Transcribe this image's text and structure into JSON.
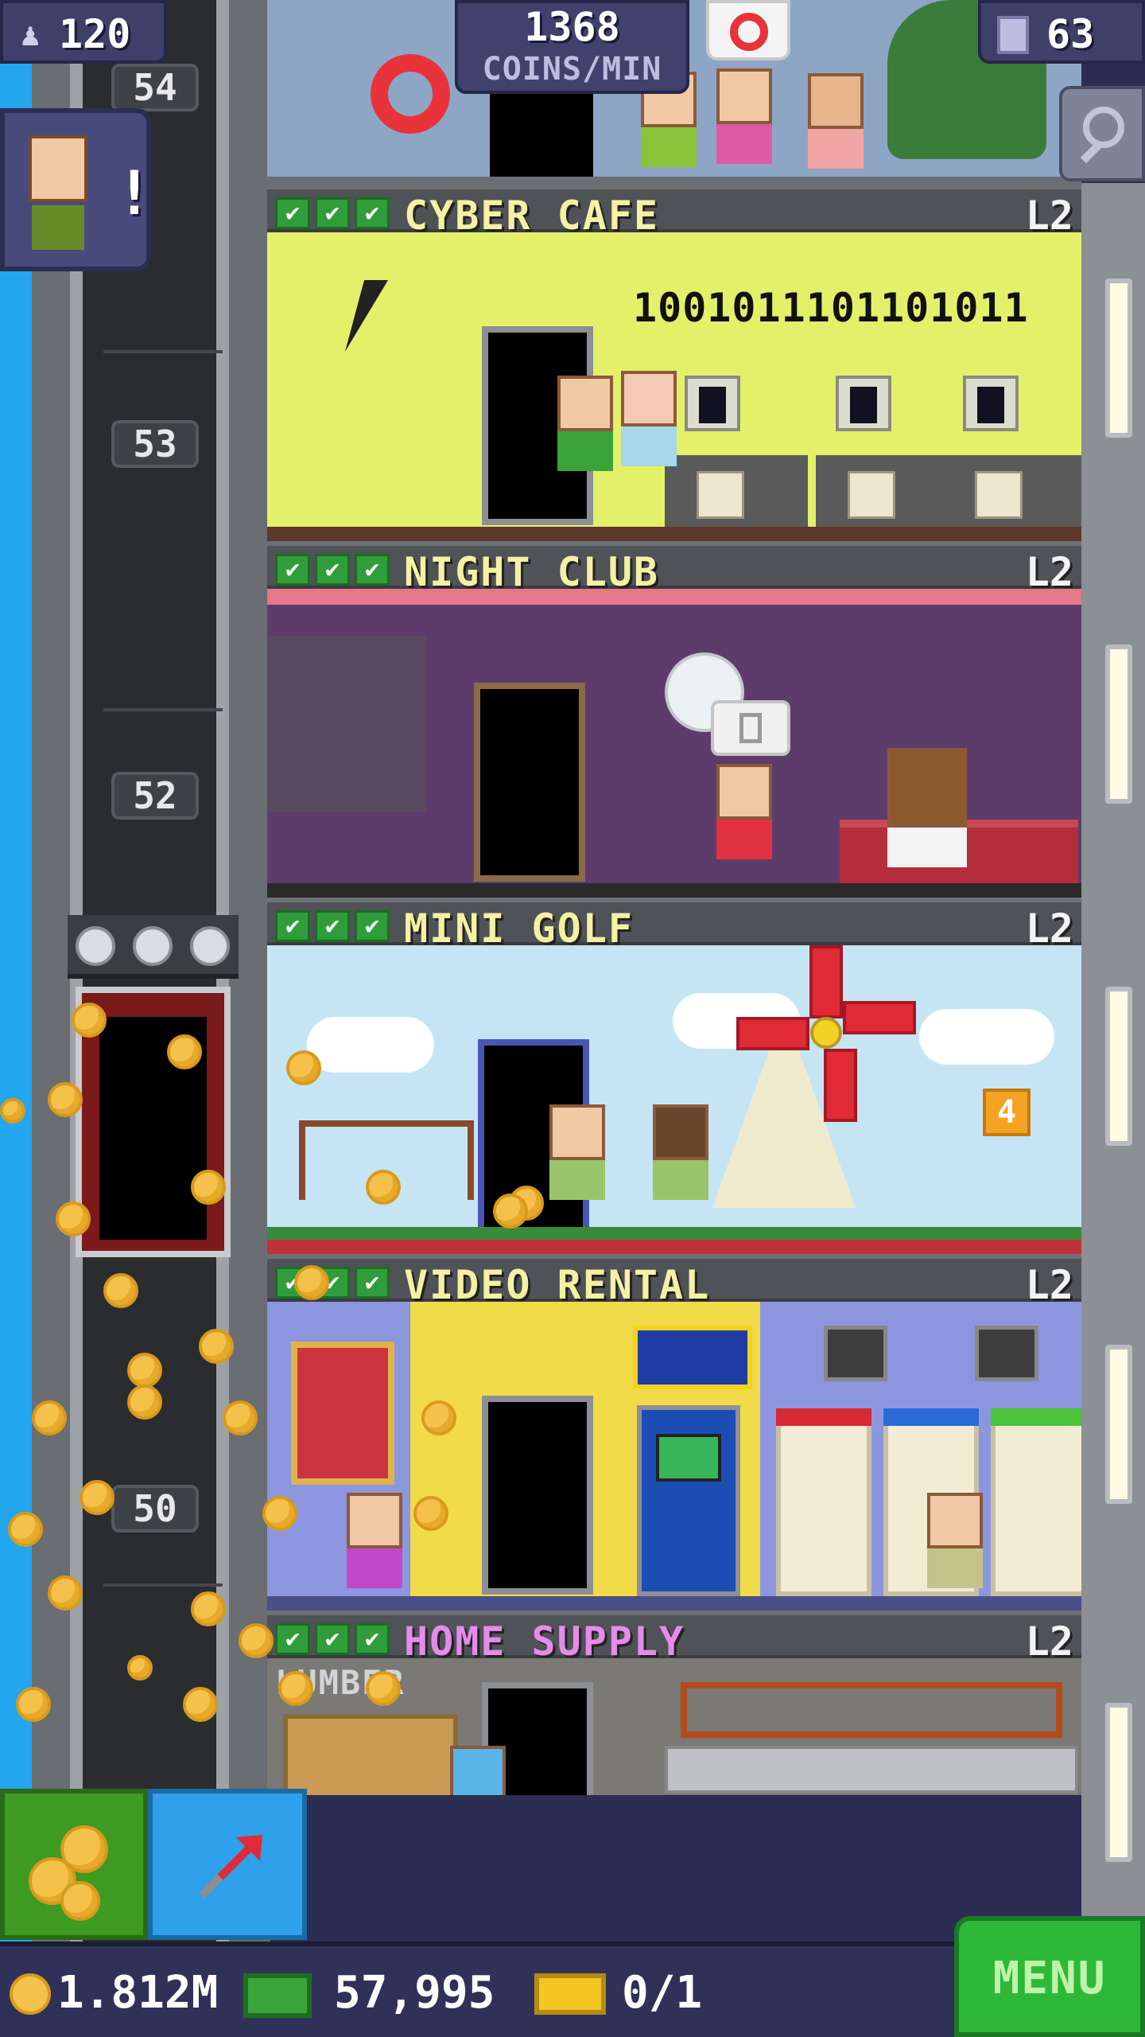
{
  "hud": {
    "population": "120",
    "coins_per_min_value": "1368",
    "coins_per_min_label": "COINS/MIN",
    "floor_count": "63",
    "visitor_alert": "!"
  },
  "elevator": {
    "floor_markers": [
      "54",
      "53",
      "52",
      "50"
    ]
  },
  "floors": [
    {
      "name": "CYBER CAFE",
      "level": "L2",
      "stocked": 3,
      "sign_text": "1001011101101011"
    },
    {
      "name": "NIGHT CLUB",
      "level": "L2",
      "stocked": 3
    },
    {
      "name": "MINI GOLF",
      "level": "L2",
      "stocked": 3,
      "hole_number": "4"
    },
    {
      "name": "VIDEO RENTAL",
      "level": "L2",
      "stocked": 3
    },
    {
      "name": "HOME SUPPLY",
      "level": "L2",
      "stocked": 3,
      "sign_text": "LUMBER"
    }
  ],
  "checkmark": "✔",
  "bottom_bar": {
    "coins": "1.812M",
    "bux": "57,995",
    "tickets": "0/1",
    "menu_label": "MENU"
  },
  "colors": {
    "sky": "#23a6ee",
    "hud_bg": "#3e4069",
    "menu_green": "#2eb83a",
    "floor_title": "#f4f1a4",
    "floor_title_home_supply": "#e58be9"
  },
  "icons": {
    "population": "person-icon",
    "floors": "building-icon",
    "search": "magnifier-icon",
    "bux_button": "coins-icon",
    "rocket_button": "arrow-up-icon",
    "notification": "lifebuoy-icon"
  }
}
